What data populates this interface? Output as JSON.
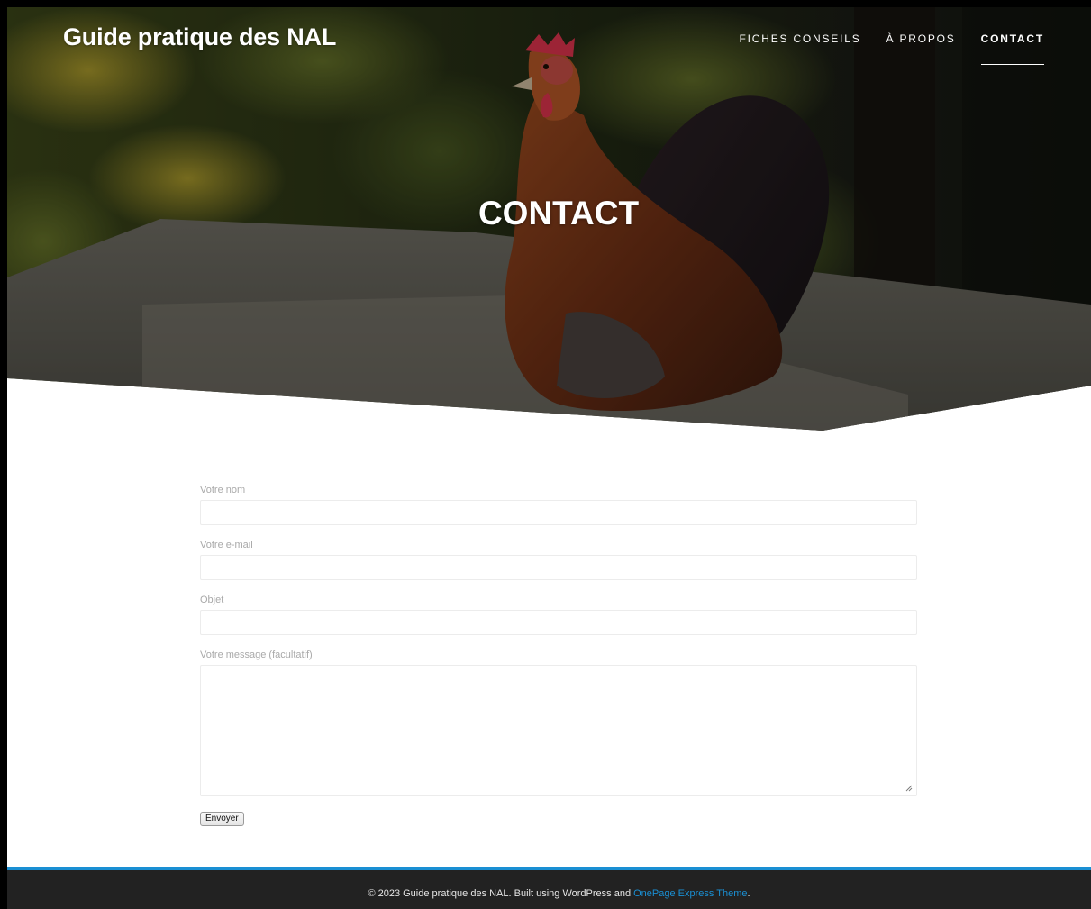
{
  "site": {
    "title": "Guide pratique des NAL"
  },
  "nav": {
    "items": [
      {
        "label": "FICHES CONSEILS"
      },
      {
        "label": "À PROPOS"
      },
      {
        "label": "CONTACT"
      }
    ]
  },
  "hero": {
    "heading": "CONTACT"
  },
  "form": {
    "name_label": "Votre nom",
    "email_label": "Votre e-mail",
    "subject_label": "Objet",
    "message_label": "Votre message (facultatif)",
    "submit_label": "Envoyer"
  },
  "footer": {
    "text": "© 2023 Guide pratique des NAL. Built using WordPress and ",
    "link_label": "OnePage Express Theme",
    "suffix": "."
  },
  "colors": {
    "accent": "#1a8fd3",
    "footer_bg": "#222222"
  }
}
